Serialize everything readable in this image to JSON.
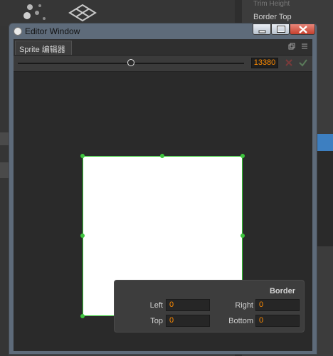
{
  "background": {
    "right_panel_label": "Border Top",
    "right_panel_faint_label": "Trim Height"
  },
  "window": {
    "title": "Editor Window",
    "tab_label": "Sprite 编辑器"
  },
  "toolbar": {
    "zoom_value": "13380",
    "slider_fraction": 0.5
  },
  "border_panel": {
    "title": "Border",
    "left_label": "Left",
    "left_value": "0",
    "right_label": "Right",
    "right_value": "0",
    "top_label": "Top",
    "top_value": "0",
    "bottom_label": "Bottom",
    "bottom_value": "0"
  },
  "colors": {
    "accent_orange": "#ff8b00",
    "sprite_outline": "#32c832",
    "canvas_bg": "#2a2a2a"
  }
}
